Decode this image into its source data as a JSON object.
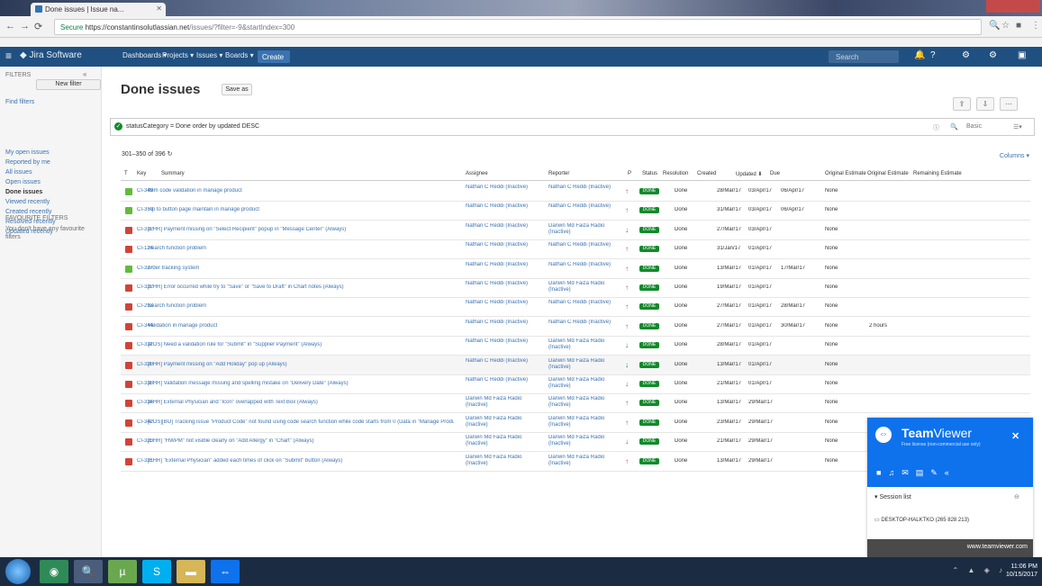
{
  "browser": {
    "tab_title": "Done issues | Issue na...",
    "url_secure": "Secure",
    "url_host": "https://constantinsolutlassian.net",
    "url_path": "/issues/?filter=-9&startIndex=300"
  },
  "jira_nav": {
    "logo": "Jira Software",
    "dashboards": "Dashboards ▾",
    "projects": "Projects ▾",
    "issues": "Issues ▾",
    "boards": "Boards ▾",
    "create": "Create",
    "search_placeholder": "Search"
  },
  "sidebar": {
    "heading": "FILTERS",
    "new_filter": "New filter",
    "find_filters": "Find filters",
    "items": [
      {
        "label": "My open issues",
        "active": false
      },
      {
        "label": "Reported by me",
        "active": false
      },
      {
        "label": "All issues",
        "active": false
      },
      {
        "label": "Open issues",
        "active": false
      },
      {
        "label": "Done issues",
        "active": true
      },
      {
        "label": "Viewed recently",
        "active": false
      },
      {
        "label": "Created recently",
        "active": false
      },
      {
        "label": "Resolved recently",
        "active": false
      },
      {
        "label": "Updated recently",
        "active": false
      }
    ],
    "favourite_heading": "FAVOURITE FILTERS",
    "favourite_text": "You don't have any favourite filters"
  },
  "main": {
    "title": "Done issues",
    "save_as": "Save as",
    "jql": "statusCategory = Done order by updated DESC",
    "basic": "Basic",
    "count": "301–350 of 396",
    "columns": "Columns ▾"
  },
  "table": {
    "headers": {
      "t": "T",
      "key": "Key",
      "summary": "Summary",
      "assignee": "Assignee",
      "reporter": "Reporter",
      "p": "P",
      "status": "Status",
      "resolution": "Resolution",
      "created": "Created",
      "updated": "Updated ⬇",
      "due": "Due",
      "orig": "Original Estimate",
      "orig2": "Original Estimate",
      "remain": "Remaining Estimate"
    },
    "rows": [
      {
        "type": "story",
        "key": "CI-349",
        "summary": "Item code validation in manage product",
        "assignee": "Nathan C Reddi (Inactive)",
        "reporter": "Nathan C Reddi (Inactive)",
        "prio": "↑",
        "status": "DONE",
        "resolution": "Done",
        "created": "28/Mar/17",
        "updated": "03/Apr/17",
        "due": "06/Apr/17",
        "orig": "None",
        "remain": ""
      },
      {
        "type": "story",
        "key": "CI-350",
        "summary": "Tip to button page maintain in manage product",
        "assignee": "Nathan C Reddi (Inactive)",
        "reporter": "Nathan C Reddi (Inactive)",
        "prio": "↑",
        "status": "DONE",
        "resolution": "Done",
        "created": "31/Mar/17",
        "updated": "03/Apr/17",
        "due": "06/Apr/17",
        "orig": "None",
        "remain": ""
      },
      {
        "type": "bug",
        "key": "CI-312",
        "summary": "[EHR] Payment missing on \"Select Recipient\" popup in \"Message Center\" (Always)",
        "assignee": "Nathan C Reddi (Inactive)",
        "reporter": "Darwin Md Faiza Radio (Inactive)",
        "prio": "↓",
        "status": "DONE",
        "resolution": "Done",
        "created": "27/Mar/17",
        "updated": "03/Apr/17",
        "due": "",
        "orig": "None",
        "remain": ""
      },
      {
        "type": "bug",
        "key": "CI-124",
        "summary": "Search function problem",
        "assignee": "Nathan C Reddi (Inactive)",
        "reporter": "Nathan C Reddi (Inactive)",
        "prio": "↑",
        "status": "DONE",
        "resolution": "Done",
        "created": "31/Jan/17",
        "updated": "01/Apr/17",
        "due": "",
        "orig": "None",
        "remain": ""
      },
      {
        "type": "story",
        "key": "CI-327",
        "summary": "order tracking system",
        "assignee": "Nathan C Reddi (Inactive)",
        "reporter": "Nathan C Reddi (Inactive)",
        "prio": "↑",
        "status": "DONE",
        "resolution": "Done",
        "created": "13/Mar/17",
        "updated": "01/Apr/17",
        "due": "17/Mar/17",
        "orig": "None",
        "remain": ""
      },
      {
        "type": "bug",
        "key": "CI-322",
        "summary": "[EHR] Error occurred while try to \"Save\" or \"Save to Draft\" in Chart notes (Always)",
        "assignee": "Nathan C Reddi (Inactive)",
        "reporter": "Darwin Md Faiza Radio (Inactive)",
        "prio": "↑",
        "status": "DONE",
        "resolution": "Done",
        "created": "19/Mar/17",
        "updated": "01/Apr/17",
        "due": "",
        "orig": "None",
        "remain": ""
      },
      {
        "type": "bug",
        "key": "CI-293",
        "summary": "Search function problem",
        "assignee": "Nathan C Reddi (Inactive)",
        "reporter": "Nathan C Reddi (Inactive)",
        "prio": "↑",
        "status": "DONE",
        "resolution": "Done",
        "created": "27/Mar/17",
        "updated": "01/Apr/17",
        "due": "28/Mar/17",
        "orig": "None",
        "remain": ""
      },
      {
        "type": "bug",
        "key": "CI-344",
        "summary": "Validation in manage product",
        "assignee": "Nathan C Reddi (Inactive)",
        "reporter": "Nathan C Reddi (Inactive)",
        "prio": "↑",
        "status": "DONE",
        "resolution": "Done",
        "created": "27/Mar/17",
        "updated": "01/Apr/17",
        "due": "30/Mar/17",
        "orig": "None",
        "remain": "2 hours"
      },
      {
        "type": "bug",
        "key": "CI-311",
        "summary": "[POS] Need a validation rule for \"Submit\" in \"Supplier Payment\" (Always)",
        "assignee": "Nathan C Reddi (Inactive)",
        "reporter": "Darwin Md Faiza Radio (Inactive)",
        "prio": "↓",
        "status": "DONE",
        "resolution": "Done",
        "created": "28/Mar/17",
        "updated": "01/Apr/17",
        "due": "",
        "orig": "None",
        "remain": ""
      },
      {
        "type": "bug",
        "key": "CI-320",
        "summary": "[EHR] Payment missing on \"Add Holiday\" pop up (Always)",
        "assignee": "Nathan C Reddi (Inactive)",
        "reporter": "Darwin Md Faiza Radio (Inactive)",
        "prio": "↓",
        "status": "DONE",
        "resolution": "Done",
        "created": "13/Mar/17",
        "updated": "01/Apr/17",
        "due": "",
        "orig": "None",
        "remain": ""
      },
      {
        "type": "bug",
        "key": "CI-318",
        "summary": "[EHR] Validation message missing and spelling mistake on \"Delivery Date\" (Always)",
        "assignee": "Nathan C Reddi (Inactive)",
        "reporter": "Darwin Md Faiza Radio (Inactive)",
        "prio": "↓",
        "status": "DONE",
        "resolution": "Done",
        "created": "21/Mar/17",
        "updated": "01/Apr/17",
        "due": "",
        "orig": "None",
        "remain": ""
      },
      {
        "type": "bug",
        "key": "CI-314",
        "summary": "[EHR] External Physician and \"Icon\" overlapped with Text Box (Always)",
        "assignee": "Darwin Md Faiza Radio (Inactive)",
        "reporter": "Darwin Md Faiza Radio (Inactive)",
        "prio": "↑",
        "status": "DONE",
        "resolution": "Done",
        "created": "13/Mar/17",
        "updated": "29/Mar/17",
        "due": "",
        "orig": "None",
        "remain": ""
      },
      {
        "type": "bug",
        "key": "CI-342",
        "summary": "[POS][BO] Tracking issue \"Product Code\" not found using code search function while code starts from 0 (Data in \"Manage Products\" (Always)",
        "assignee": "Darwin Md Faiza Radio (Inactive)",
        "reporter": "Darwin Md Faiza Radio (Inactive)",
        "prio": "↑",
        "status": "DONE",
        "resolution": "Done",
        "created": "23/Mar/17",
        "updated": "29/Mar/17",
        "due": "",
        "orig": "None",
        "remain": ""
      },
      {
        "type": "bug",
        "key": "CI-323",
        "summary": "[EHR] \"HWPM\" not visible clearly on \"Add Allergy\" in \"Chart\" (Always)",
        "assignee": "Darwin Md Faiza Radio (Inactive)",
        "reporter": "Darwin Md Faiza Radio (Inactive)",
        "prio": "↓",
        "status": "DONE",
        "resolution": "Done",
        "created": "21/Mar/17",
        "updated": "29/Mar/17",
        "due": "",
        "orig": "None",
        "remain": ""
      },
      {
        "type": "bug",
        "key": "CI-321",
        "summary": "[EHR] \"External Physician\" added each times of click on \"Submit\" button (Always)",
        "assignee": "Darwin Md Faiza Radio (Inactive)",
        "reporter": "Darwin Md Faiza Radio (Inactive)",
        "prio": "↑",
        "status": "DONE",
        "resolution": "Done",
        "created": "13/Mar/17",
        "updated": "29/Mar/17",
        "due": "",
        "orig": "None",
        "remain": ""
      }
    ]
  },
  "teamviewer": {
    "title_a": "Team",
    "title_b": "Viewer",
    "subtitle": "Free license (non-commercial use only)",
    "session_list": "▾ Session list",
    "desktop": "DESKTOP-HALKTKO (265 828 213)",
    "footer": "www.teamviewer.com"
  },
  "clock": {
    "time": "11:06 PM",
    "date": "10/15/2017"
  },
  "colors": {
    "jira_blue": "#205081",
    "story": "#63ba3c",
    "bug": "#d04437",
    "done": "#14892c",
    "prio_up": "#d04437",
    "prio_down": "#14892c",
    "teamviewer": "#0e72ed"
  },
  "icons": {
    "nav": [
      "back-icon",
      "forward-icon",
      "reload-icon"
    ],
    "tray": [
      "network-icon",
      "volume-icon",
      "flag-icon"
    ]
  }
}
